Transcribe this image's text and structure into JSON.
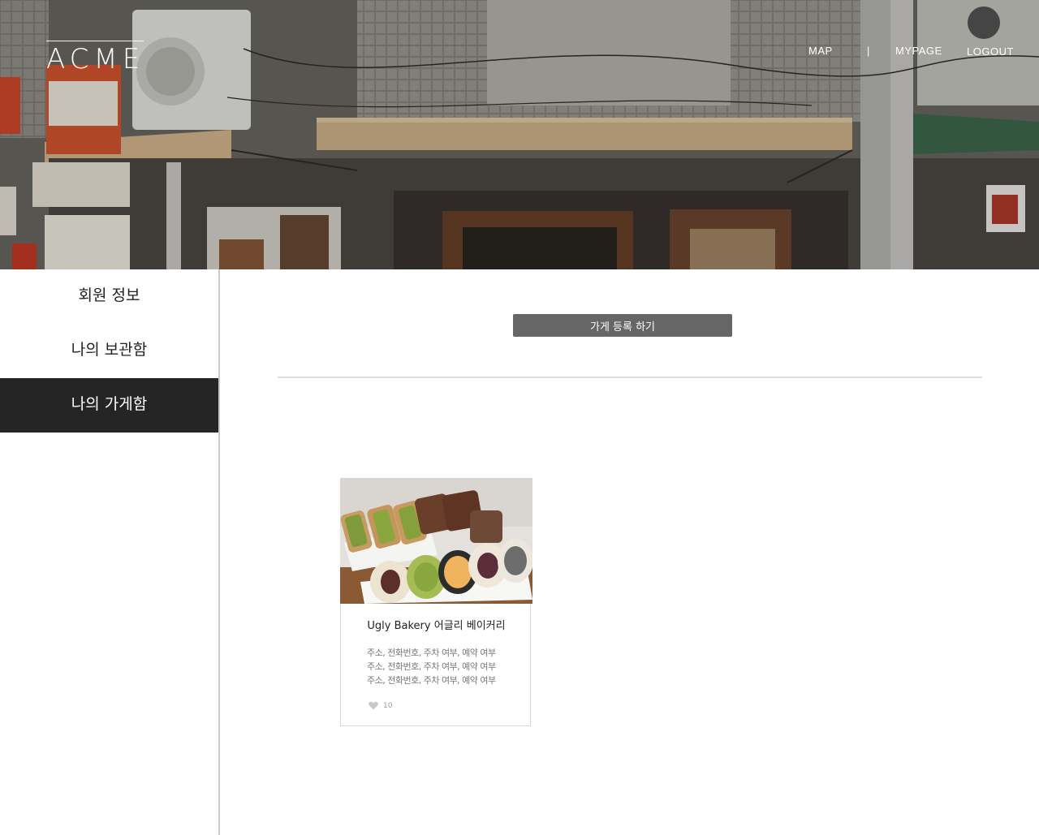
{
  "header": {
    "logo": "ACME",
    "nav": {
      "map": "MAP",
      "separator": "|",
      "mypage": "MYPAGE",
      "logout": "LOGOUT"
    }
  },
  "sidebar": {
    "items": [
      {
        "label": "회원 정보",
        "active": false
      },
      {
        "label": "나의 보관함",
        "active": false
      },
      {
        "label": "나의 가게함",
        "active": true
      }
    ]
  },
  "main": {
    "register_button": "가게 등록 하기",
    "stores": [
      {
        "name": "Ugly Bakery 어글리 베이커리",
        "info_lines": [
          "주소, 전화번호, 주차 여부, 예약 여부",
          "주소, 전화번호, 주차 여부, 예약 여부",
          "주소, 전화번호, 주차 여부, 예약 여부"
        ],
        "likes": "10",
        "like_icon": "heart-icon"
      }
    ]
  },
  "colors": {
    "sidebar_active_bg": "#252525",
    "button_bg": "#666666",
    "divider": "#dcdcdc"
  }
}
